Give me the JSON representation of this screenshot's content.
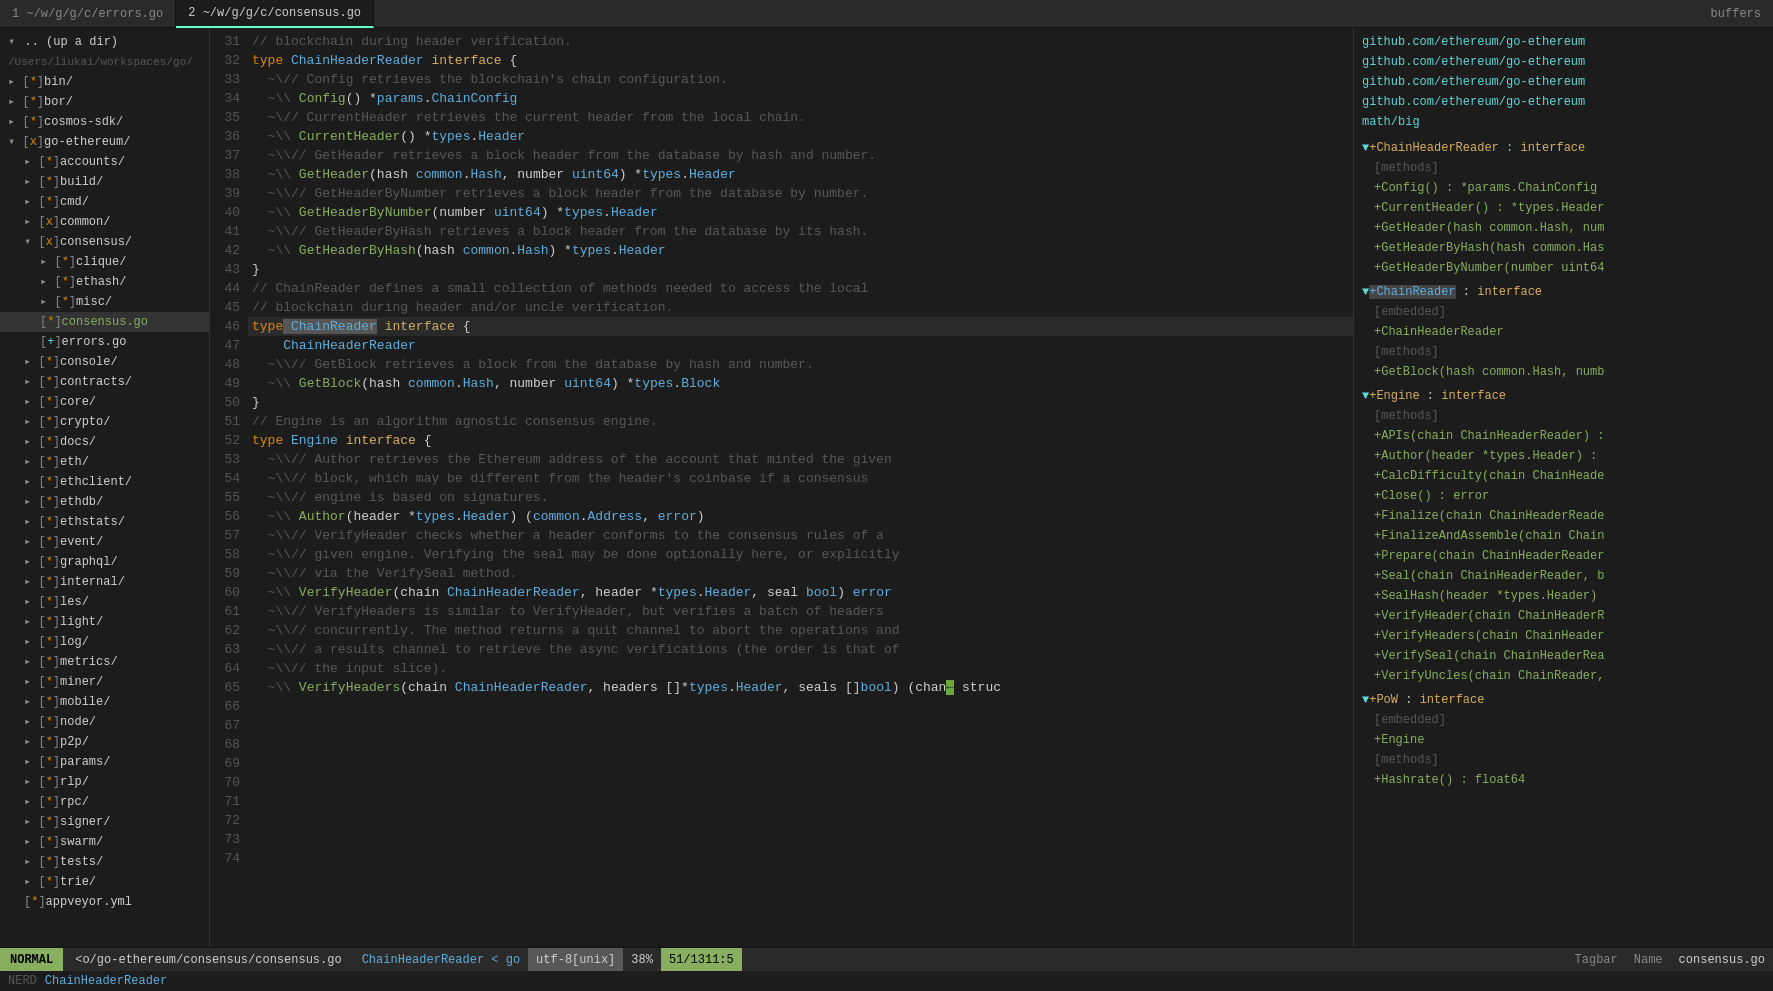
{
  "tabs": [
    {
      "id": "tab1",
      "label": "1 ~/w/g/g/c/errors.go",
      "active": false
    },
    {
      "id": "tab2",
      "label": "2 ~/w/g/g/c/consensus.go",
      "active": true
    }
  ],
  "tab_buffers": "buffers",
  "sidebar": {
    "root_label": ".. (up a dir)",
    "root_path": "/Users/liukai/workspaces/go/",
    "items": [
      {
        "indent": 2,
        "icon": "[*]",
        "name": "bin/",
        "type": "dir"
      },
      {
        "indent": 2,
        "icon": "[*]",
        "name": "bor/",
        "type": "dir"
      },
      {
        "indent": 2,
        "icon": "[*]",
        "name": "cosmos-sdk/",
        "type": "dir"
      },
      {
        "indent": 2,
        "icon": "[x]",
        "name": "go-ethereum/",
        "type": "dir",
        "open": true
      },
      {
        "indent": 4,
        "icon": "[*]",
        "name": "accounts/",
        "type": "dir"
      },
      {
        "indent": 4,
        "icon": "[*]",
        "name": "build/",
        "type": "dir"
      },
      {
        "indent": 4,
        "icon": "[*]",
        "name": "cmd/",
        "type": "dir"
      },
      {
        "indent": 4,
        "icon": "[x]",
        "name": "common/",
        "type": "dir",
        "open": true
      },
      {
        "indent": 4,
        "icon": "[x]",
        "name": "consensus/",
        "type": "dir",
        "open": true
      },
      {
        "indent": 6,
        "icon": "[*]",
        "name": "clique/",
        "type": "dir"
      },
      {
        "indent": 6,
        "icon": "[*]",
        "name": "ethash/",
        "type": "dir"
      },
      {
        "indent": 6,
        "icon": "[*]",
        "name": "misc/",
        "type": "dir"
      },
      {
        "indent": 6,
        "icon": "[*]",
        "name": "consensus.go",
        "type": "file",
        "active": true
      },
      {
        "indent": 6,
        "icon": "[+]",
        "name": "errors.go",
        "type": "file"
      },
      {
        "indent": 4,
        "icon": "[*]",
        "name": "console/",
        "type": "dir"
      },
      {
        "indent": 4,
        "icon": "[*]",
        "name": "contracts/",
        "type": "dir"
      },
      {
        "indent": 4,
        "icon": "[*]",
        "name": "core/",
        "type": "dir"
      },
      {
        "indent": 4,
        "icon": "[*]",
        "name": "crypto/",
        "type": "dir"
      },
      {
        "indent": 4,
        "icon": "[*]",
        "name": "docs/",
        "type": "dir"
      },
      {
        "indent": 4,
        "icon": "[*]",
        "name": "eth/",
        "type": "dir"
      },
      {
        "indent": 4,
        "icon": "[*]",
        "name": "ethclient/",
        "type": "dir"
      },
      {
        "indent": 4,
        "icon": "[*]",
        "name": "ethdb/",
        "type": "dir"
      },
      {
        "indent": 4,
        "icon": "[*]",
        "name": "ethstats/",
        "type": "dir"
      },
      {
        "indent": 4,
        "icon": "[*]",
        "name": "event/",
        "type": "dir"
      },
      {
        "indent": 4,
        "icon": "[*]",
        "name": "graphql/",
        "type": "dir"
      },
      {
        "indent": 4,
        "icon": "[*]",
        "name": "internal/",
        "type": "dir"
      },
      {
        "indent": 4,
        "icon": "[*]",
        "name": "les/",
        "type": "dir"
      },
      {
        "indent": 4,
        "icon": "[*]",
        "name": "light/",
        "type": "dir"
      },
      {
        "indent": 4,
        "icon": "[*]",
        "name": "log/",
        "type": "dir"
      },
      {
        "indent": 4,
        "icon": "[*]",
        "name": "metrics/",
        "type": "dir"
      },
      {
        "indent": 4,
        "icon": "[*]",
        "name": "miner/",
        "type": "dir"
      },
      {
        "indent": 4,
        "icon": "[*]",
        "name": "mobile/",
        "type": "dir"
      },
      {
        "indent": 4,
        "icon": "[*]",
        "name": "node/",
        "type": "dir"
      },
      {
        "indent": 4,
        "icon": "[*]",
        "name": "p2p/",
        "type": "dir"
      },
      {
        "indent": 4,
        "icon": "[*]",
        "name": "params/",
        "type": "dir"
      },
      {
        "indent": 4,
        "icon": "[*]",
        "name": "rlp/",
        "type": "dir"
      },
      {
        "indent": 4,
        "icon": "[*]",
        "name": "rpc/",
        "type": "dir"
      },
      {
        "indent": 4,
        "icon": "[*]",
        "name": "signer/",
        "type": "dir"
      },
      {
        "indent": 4,
        "icon": "[*]",
        "name": "swarm/",
        "type": "dir"
      },
      {
        "indent": 4,
        "icon": "[*]",
        "name": "tests/",
        "type": "dir"
      },
      {
        "indent": 4,
        "icon": "[*]",
        "name": "trie/",
        "type": "dir"
      },
      {
        "indent": 4,
        "icon": "[*]",
        "name": "appveyor.yml",
        "type": "file"
      }
    ]
  },
  "status": {
    "mode": "NORMAL",
    "file": "<o/go-ethereum/consensus/consensus.go",
    "tag": "ChainHeaderReader",
    "arrow": "< go",
    "encoding": "utf-8[unix]",
    "percent": "38%",
    "position": "51/131",
    "col": "1:5",
    "tagbar": "Tagbar",
    "name_label": "Name",
    "filename": "consensus.go"
  },
  "bottom": {
    "mode": "NERD",
    "tag": "ChainHeaderReader"
  },
  "right_panel": {
    "packages": [
      "github.com/ethereum/go-ethereum",
      "github.com/ethereum/go-ethereum",
      "github.com/ethereum/go-ethereum",
      "github.com/ethereum/go-ethereum",
      "math/big"
    ],
    "sections": [
      {
        "name": "ChainHeaderReader",
        "type": "interface",
        "indicator": "▼+",
        "sub": "[methods]",
        "methods": [
          "+Config() : *params.ChainConfig",
          "+CurrentHeader() : *types.Header",
          "+GetHeader(hash common.Hash, num",
          "+GetHeaderByHash(hash common.Has",
          "+GetHeaderByNumber(number uint64"
        ]
      },
      {
        "name": "ChainReader",
        "type": "interface",
        "indicator": "▼+",
        "highlight": true,
        "sub": "[embedded]",
        "embedded": "+ChainHeaderReader",
        "methods_label": "[methods]",
        "methods": [
          "+GetBlock(hash common.Hash, numb"
        ]
      },
      {
        "name": "Engine",
        "type": "interface",
        "indicator": "▼+",
        "sub": "[methods]",
        "methods": [
          "+APIs(chain ChainHeaderReader) :",
          "+Author(header *types.Header) :",
          "+CalcDifficulty(chain ChainHeade",
          "+Close() : error",
          "+Finalize(chain ChainHeaderReade",
          "+FinalizeAndAssemble(chain Chain",
          "+Prepare(chain ChainHeaderReader",
          "+Seal(chain ChainHeaderReader, b",
          "+SealHash(header *types.Header)",
          "+VerifyHeader(chain ChainHeaderR",
          "+VerifyHeaders(chain ChainHeader",
          "+VerifySeal(chain ChainHeaderRea",
          "+VerifyUncles(chain ChainReader,"
        ]
      },
      {
        "name": "PoW",
        "type": "interface",
        "indicator": "▼+",
        "sub": "[embedded]",
        "embedded": "+Engine",
        "methods_label": "[methods]",
        "methods": [
          "+Hashrate() : float64"
        ]
      }
    ]
  }
}
